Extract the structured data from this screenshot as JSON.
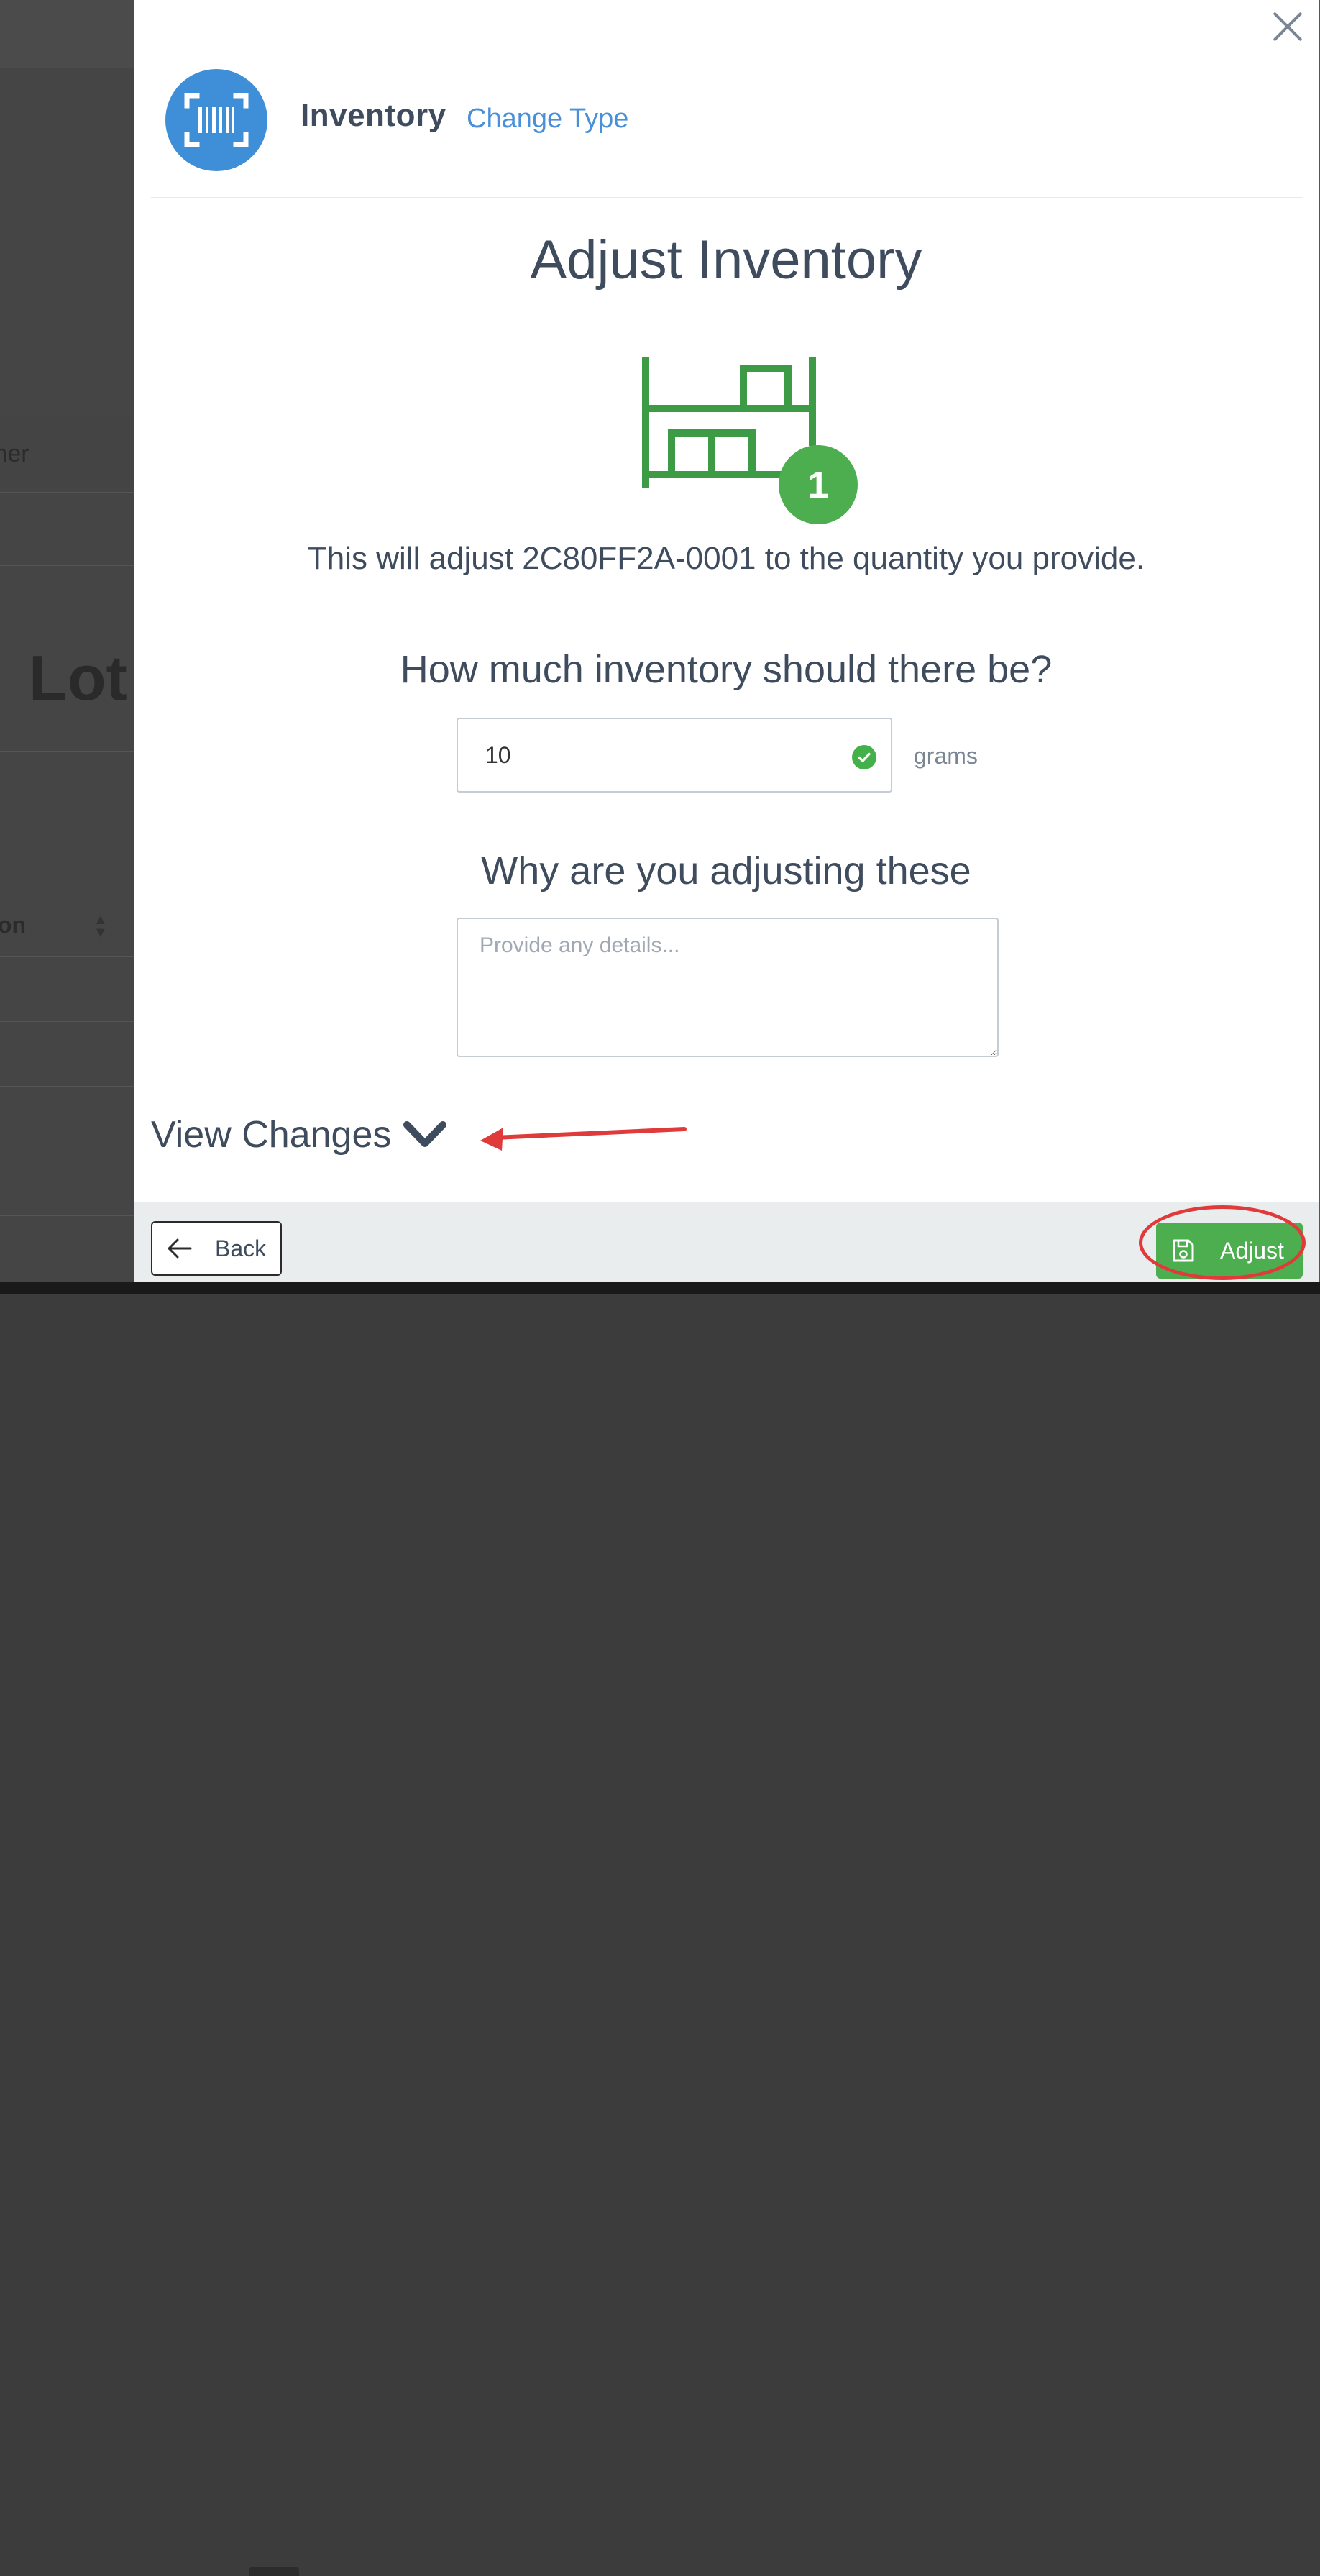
{
  "background": {
    "customer_fragment": "mer",
    "heading_fragment": "Lot",
    "column_fragment": "ion"
  },
  "header": {
    "icon": "barcode-scan-icon",
    "title": "Inventory",
    "change_type_link": "Change Type",
    "close_icon": "close-icon"
  },
  "main": {
    "title": "Adjust Inventory",
    "illustration": "shelf-boxes-icon",
    "badge_count": "1",
    "description": "This will adjust 2C80FF2A-0001 to the quantity you provide.",
    "quantity_question": "How much inventory should there be?",
    "quantity_value": "10",
    "quantity_unit": "grams",
    "reason_question": "Why are you adjusting these",
    "reason_placeholder": "Provide any details...",
    "view_changes_label": "View Changes"
  },
  "footer": {
    "back_label": "Back",
    "adjust_label": "Adjust"
  },
  "colors": {
    "accent_blue": "#3f8fd8",
    "link_blue": "#4a90d9",
    "success_green": "#4cae4f",
    "annotation_red": "#e03a3a",
    "text_dark": "#3e4c5e"
  }
}
